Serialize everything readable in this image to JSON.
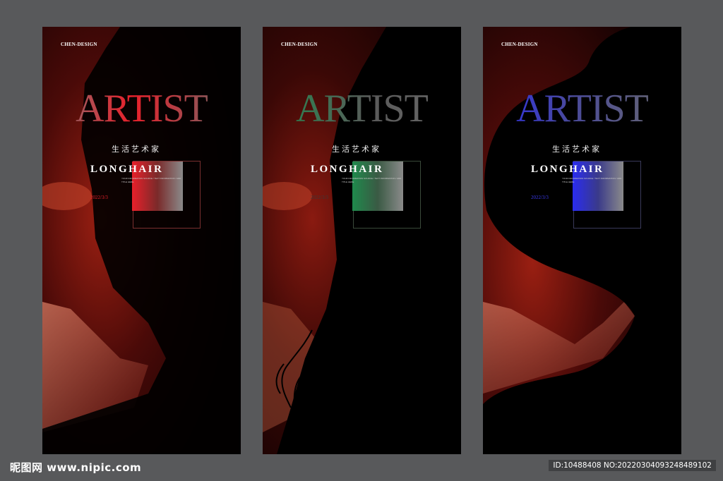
{
  "posters": [
    {
      "brand": "CHEN-DESIGN",
      "title": "ARTIST",
      "subtitle": "生活艺术家",
      "headline": "LONGHAIR",
      "small_text": "YOUR INFORMATION SOURCE / TEXT INFORMATION / ADD TITLE HERE",
      "date": "2022/3/3",
      "accent_color": "#e8202a"
    },
    {
      "brand": "CHEN-DESIGN",
      "title": "ARTIST",
      "subtitle": "生活艺术家",
      "headline": "LONGHAIR",
      "small_text": "YOUR INFORMATION SOURCE / TEXT INFORMATION / ADD TITLE HERE",
      "date": "2022/3/3",
      "accent_color": "#1f8a4c"
    },
    {
      "brand": "CHEN-DESIGN",
      "title": "ARTIST",
      "subtitle": "生活艺术家",
      "headline": "LONGHAIR",
      "small_text": "YOUR INFORMATION SOURCE / TEXT INFORMATION / ADD TITLE HERE",
      "date": "2022/3/3",
      "accent_color": "#2a2cf0"
    }
  ],
  "footer": {
    "logo_text": "昵图网 www.nipic.com",
    "id_text": "ID:10488408 NO:20220304093248489102"
  }
}
